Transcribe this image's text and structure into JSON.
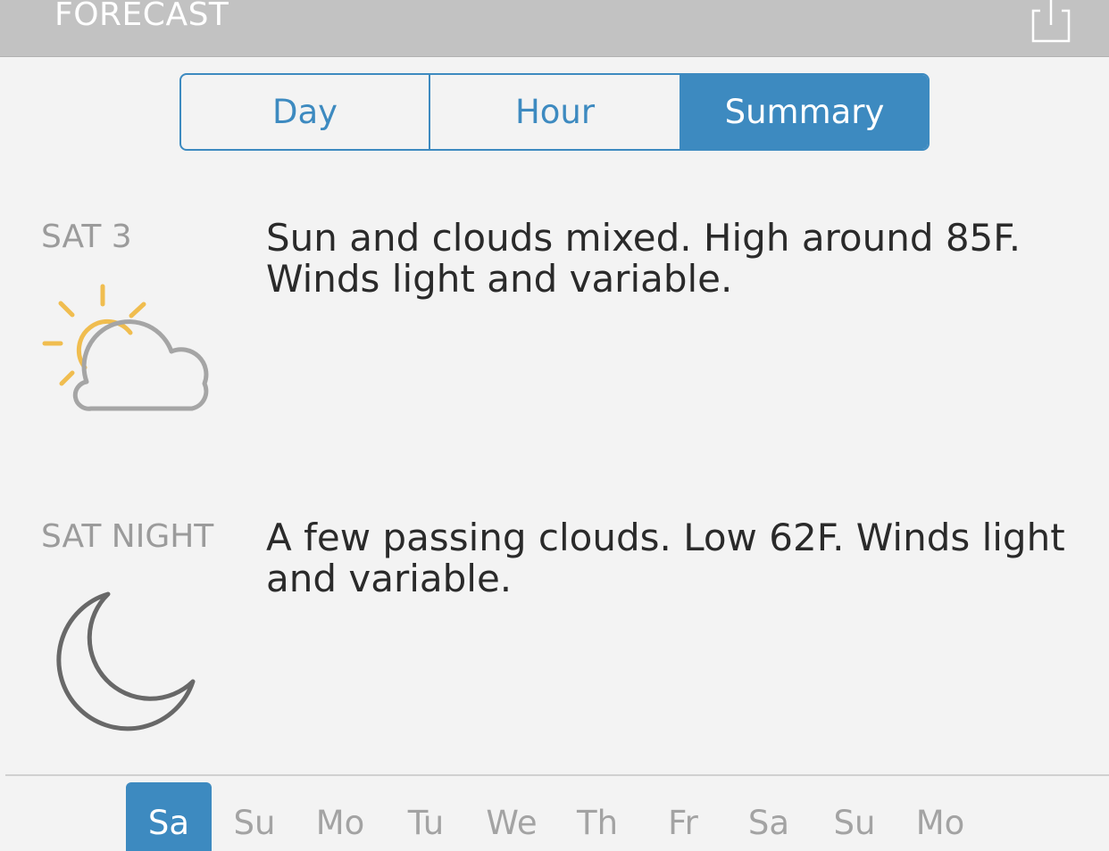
{
  "header": {
    "title": "FORECAST",
    "share_icon": "share-icon"
  },
  "tabs": [
    {
      "label": "Day",
      "active": false
    },
    {
      "label": "Hour",
      "active": false
    },
    {
      "label": "Summary",
      "active": true
    }
  ],
  "periods": [
    {
      "label": "SAT 3",
      "text": "Sun and clouds mixed. High around 85F. Winds light and variable.",
      "icon": "partly-cloudy-icon"
    },
    {
      "label": "SAT NIGHT",
      "text": "A few passing clouds. Low 62F. Winds light and variable.",
      "icon": "moon-icon"
    }
  ],
  "day_tabs": [
    "Sa",
    "Su",
    "Mo",
    "Tu",
    "We",
    "Th",
    "Fr",
    "Sa",
    "Su",
    "Mo"
  ],
  "active_day_index": 0,
  "colors": {
    "accent": "#3d8ac0",
    "header": "#c2c2c2",
    "sun": "#f0bd4f",
    "cloud": "#a5a5a5",
    "moon": "#686868"
  }
}
